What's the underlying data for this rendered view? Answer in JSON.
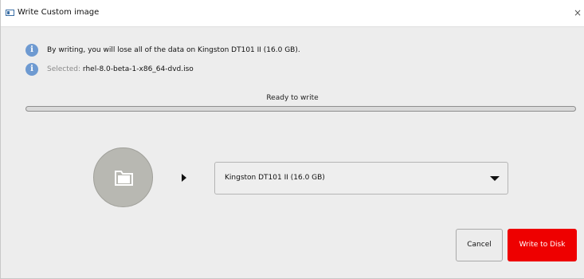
{
  "window": {
    "title": "Write Custom image",
    "close_glyph": "×"
  },
  "messages": [
    {
      "icon": "info-icon",
      "text": "By writing, you will lose all of the data on Kingston DT101 II (16.0 GB)."
    },
    {
      "icon": "info-icon",
      "prefix": "Selected:",
      "filename": "rhel-8.0-beta-1-x86_64-dvd.iso"
    }
  ],
  "status": {
    "label": "Ready to write",
    "progress_fraction": 0
  },
  "source": {
    "icon": "folder-icon"
  },
  "target": {
    "selected_drive": "Kingston DT101 II (16.0 GB)"
  },
  "buttons": {
    "cancel_label": "Cancel",
    "write_label": "Write to Disk"
  },
  "colors": {
    "accent_danger": "#ee0000",
    "info_icon": "#6e9ad1",
    "source_circle": "#b8b8b2"
  }
}
